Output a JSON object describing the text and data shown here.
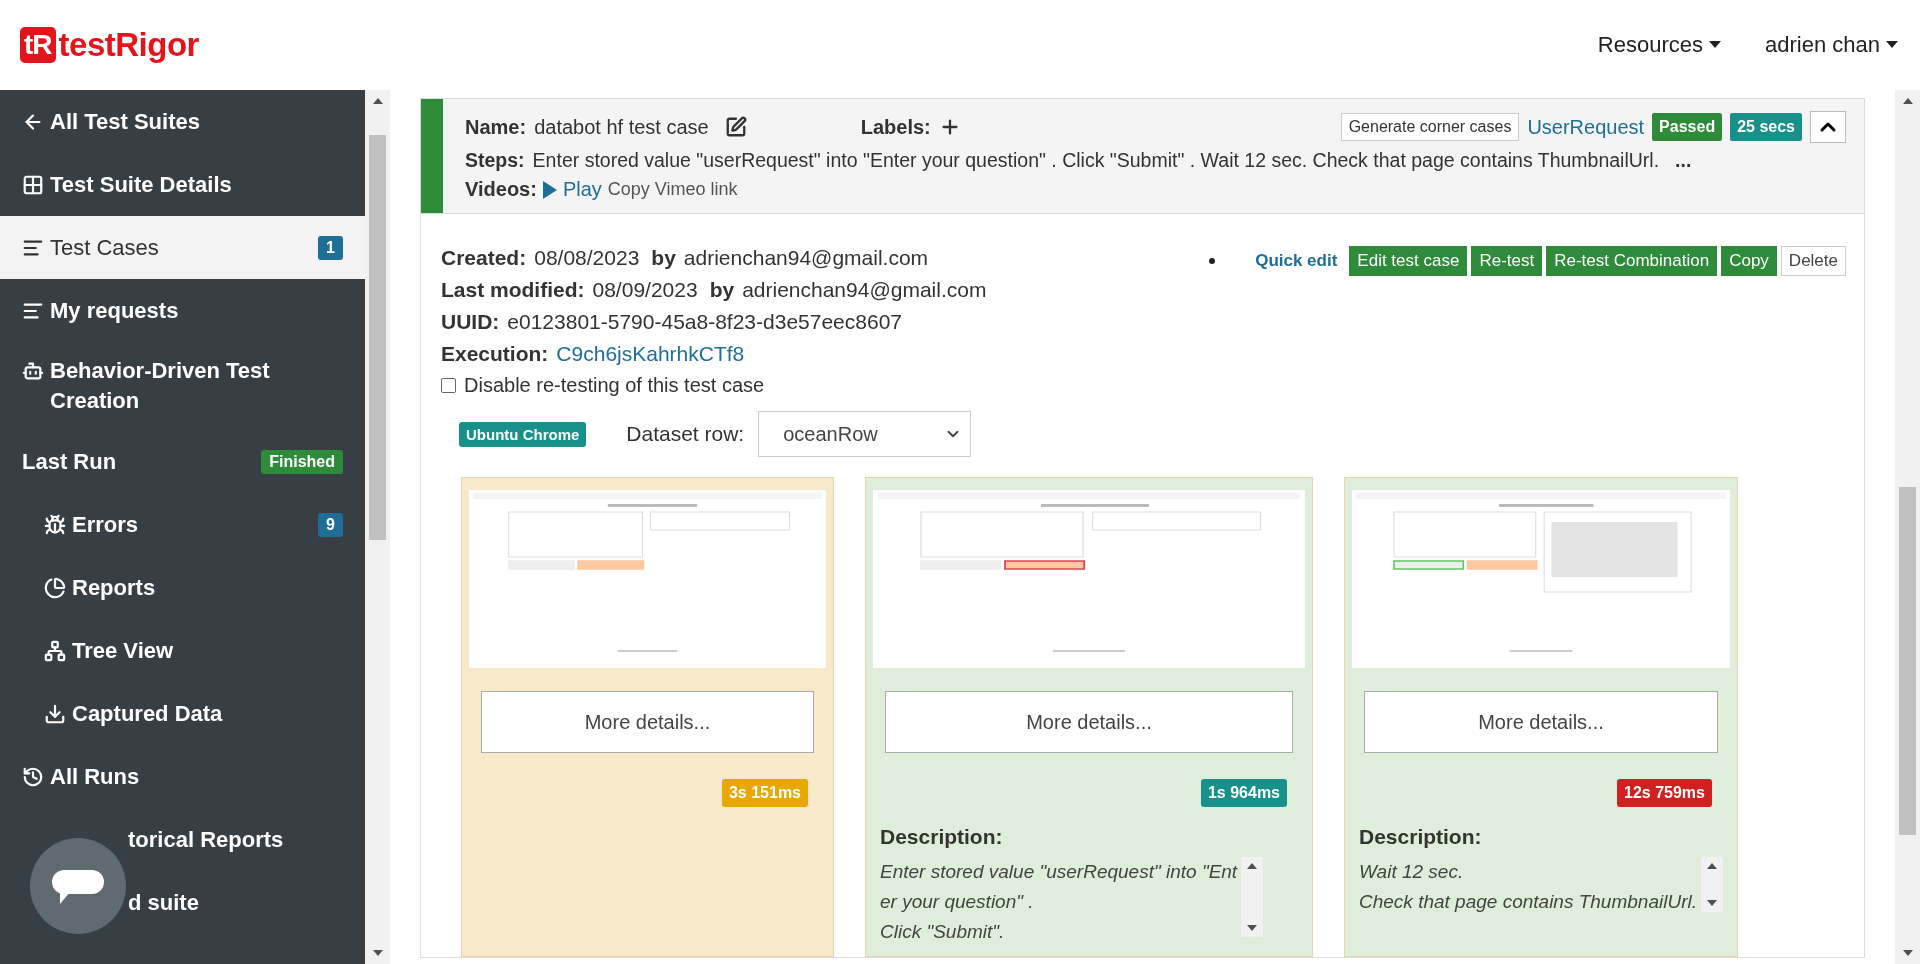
{
  "header": {
    "logo_mark": "tR",
    "logo_text": "testRigor",
    "menus": [
      {
        "label": "Resources"
      },
      {
        "label": "adrien chan"
      }
    ]
  },
  "sidebar": {
    "items": [
      {
        "label": "All Test Suites",
        "selected": false
      },
      {
        "label": "Test Suite Details",
        "selected": false
      },
      {
        "label": "Test Cases",
        "selected": true,
        "badge": {
          "text": "1",
          "color": "#1f6e96"
        }
      },
      {
        "label": "My requests",
        "selected": false
      },
      {
        "label": "Behavior-Driven Test Creation",
        "selected": false
      },
      {
        "label": "Last Run",
        "selected": false,
        "badge": {
          "text": "Finished",
          "color": "#2e8b3a"
        },
        "children": [
          {
            "label": "Errors",
            "selected": false,
            "badge": {
              "text": "9",
              "color": "#1f6e96"
            }
          },
          {
            "label": "Reports",
            "selected": false
          },
          {
            "label": "Tree View",
            "selected": false
          },
          {
            "label": "Captured Data",
            "selected": false
          }
        ]
      },
      {
        "label": "All Runs",
        "selected": false
      },
      {
        "label": "torical Reports",
        "selected": false
      },
      {
        "label": "d suite",
        "selected": false
      }
    ]
  },
  "test_case": {
    "expanded": true,
    "name_label": "Name:",
    "name": "databot hf test case",
    "labels_label": "Labels:",
    "corner_cases": "Generate corner cases",
    "tag": "UserRequest",
    "status": "Passed",
    "duration": "25 secs",
    "steps_label": "Steps:",
    "steps": "Enter stored value \"userRequest\" into \"Enter your question\" . Click \"Submit\" . Wait 12 sec. Check that page contains ThumbnailUrl.",
    "steps_more": "...",
    "videos_label": "Videos:",
    "play": "Play",
    "copy_link": "Copy Vimeo link",
    "fields": [
      {
        "label": "Created:",
        "value": "08/08/2023",
        "by_label": "by",
        "by_value": "adrienchan94@gmail.com"
      },
      {
        "label": "Last modified:",
        "value": "08/09/2023",
        "by_label": "by",
        "by_value": "adrienchan94@gmail.com"
      },
      {
        "label": "UUID:",
        "value": "e0123801-5790-45a8-8f23-d3e57eec8607"
      },
      {
        "label": "Execution:",
        "value": "C9ch6jsKahrhkCTf8",
        "kind": "link"
      }
    ],
    "disable_retest": {
      "label": "Disable re-testing of this test case",
      "checked": false
    },
    "actions": [
      {
        "label": "Quick edit",
        "kind": "link"
      },
      {
        "label": "Edit test case",
        "kind": "primary"
      },
      {
        "label": "Re-test",
        "kind": "primary"
      },
      {
        "label": "Re-test Combination",
        "kind": "primary"
      },
      {
        "label": "Copy",
        "kind": "primary"
      },
      {
        "label": "Delete",
        "kind": "default"
      }
    ],
    "platform": "Ubuntu Chrome",
    "dataset_label": "Dataset row:",
    "dataset_value": "oceanRow",
    "screenshots": [
      {
        "color": "#f9e9cb",
        "more": "More details...",
        "duration": {
          "text": "3s 151ms",
          "color": "#e9a800"
        }
      },
      {
        "color": "#dfeedb",
        "more": "More details...",
        "duration": {
          "text": "1s 964ms",
          "color": "#17918a"
        },
        "description_label": "Description:",
        "description_lines": [
          "Enter stored value \"userRequest\" into \"Ent",
          "er your question\" .",
          "Click \"Submit\"."
        ]
      },
      {
        "color": "#dfeedb",
        "more": "More details...",
        "duration": {
          "text": "12s 759ms",
          "color": "#d21f1f"
        },
        "description_label": "Description:",
        "description_lines": [
          "Wait 12 sec.",
          "Check that page contains ThumbnailUrl."
        ]
      }
    ]
  }
}
